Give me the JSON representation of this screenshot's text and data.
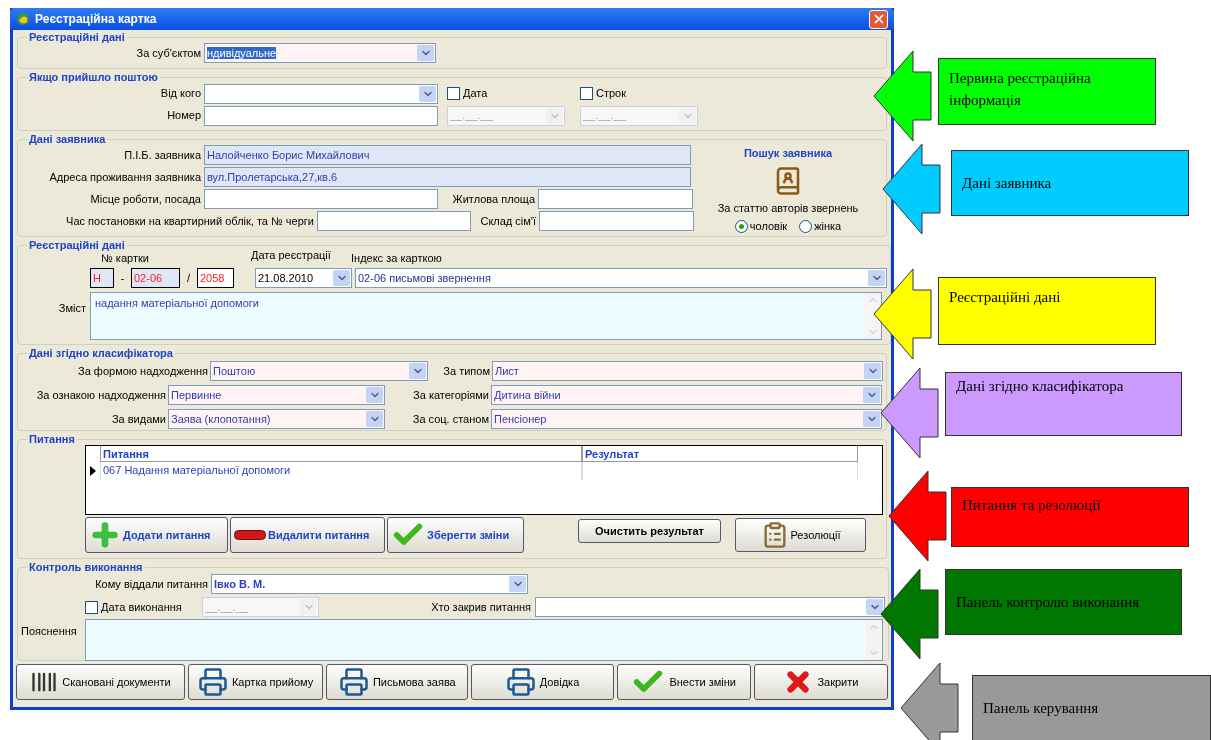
{
  "window": {
    "title": "Реєстраційна картка"
  },
  "registration": {
    "legend": "Реєстраційні дані",
    "subject": {
      "label": "За суб'єктом",
      "value": "ндивідуальне",
      "highlighted": true
    }
  },
  "mail": {
    "legend": "Якщо прийшло поштою",
    "from_label": "Від кого",
    "number_label": "Номер",
    "date": {
      "label": "Дата",
      "checked": false,
      "mask": "__.__.__"
    },
    "term": {
      "label": "Строк",
      "checked": false,
      "mask": "__.__.__"
    }
  },
  "applicant": {
    "legend": "Дані заявника",
    "fields": [
      {
        "label": "П.І.Б. заявника",
        "value": "Налойченко Борис Михайлович"
      },
      {
        "label": "Адреса проживання заявника",
        "value": "вул.Пролетарська,27,кв.6"
      },
      {
        "label": "Місце роботи, посада"
      },
      {
        "label": "Житлова площа"
      },
      {
        "label": "Час постановки на квартирний облік, та № черги"
      },
      {
        "label": "Склад сім'ї"
      }
    ],
    "search_label": "Пошук заявника",
    "gender_label": "За статтю авторів звернень",
    "genders": [
      {
        "label": "чоловік",
        "selected": true
      },
      {
        "label": "жінка",
        "selected": false
      }
    ]
  },
  "card": {
    "legend": "Реєстраційні дані",
    "number_label": "№ картки",
    "number_parts": [
      "Н",
      "02-06",
      "2058"
    ],
    "separators": [
      "-",
      "/"
    ],
    "date_label": "Дата реєстрації",
    "date": "21.08.2010",
    "index_label": "Індекс за карткою",
    "index": "02-06 письмові звернення",
    "content_label": "Зміст",
    "content": "надання матеріальної допомоги"
  },
  "classifier": {
    "legend": "Дані згідно класифікатора",
    "fields": [
      {
        "label": "За формою надходження",
        "value": "Поштою"
      },
      {
        "label": "За типом",
        "value": "Лист"
      },
      {
        "label": "За ознакою надходження",
        "value": "Первинне"
      },
      {
        "label": "За категоріями",
        "value": "Дитина війни"
      },
      {
        "label": "За видами",
        "value": "Заява (клопотання)"
      },
      {
        "label": "За соц. станом",
        "value": "Пенсіонер"
      }
    ]
  },
  "questions": {
    "legend": "Питання",
    "columns": [
      "Питання",
      "Результат"
    ],
    "rows": [
      {
        "cells": [
          "067 Надання матеріальної допомоги"
        ],
        "selected": true
      }
    ],
    "buttons": [
      {
        "label": "Додати питання",
        "kind": "plus"
      },
      {
        "label": "Видалити питання",
        "kind": "minus"
      },
      {
        "label": "Зберегти зміни",
        "kind": "check"
      }
    ],
    "side_buttons": [
      {
        "label": "Очистить результат"
      },
      {
        "label": "Резолюції",
        "kind": "clipboard"
      }
    ]
  },
  "control": {
    "legend": "Контроль виконання",
    "assigned_label": "Кому віддали питання",
    "assigned": "Івко В. М.",
    "done": {
      "label": "Дата виконання",
      "checked": false,
      "mask": "__.__.__"
    },
    "closed_label": "Хто закрив питання",
    "note_label": "Пояснення"
  },
  "toolbar": [
    {
      "label": "Скановані документи",
      "kind": "barcode"
    },
    {
      "label": "Картка прийому",
      "kind": "printer"
    },
    {
      "label": "Письмова заява",
      "kind": "printer"
    },
    {
      "label": "Довідка",
      "kind": "printer"
    },
    {
      "label": "Внести зміни",
      "kind": "check"
    },
    {
      "label": "Закрити",
      "kind": "cross"
    }
  ],
  "callouts": [
    {
      "text": "Первина реєстраційна інформація",
      "color": "#00ff00"
    },
    {
      "text": "Дані заявника",
      "color": "#00ccff"
    },
    {
      "text": "Реєстраційні дані",
      "color": "#ffff00"
    },
    {
      "text": "Дані згідно класифікатора",
      "color": "#cc99ff"
    },
    {
      "text": "Питання та резолюції",
      "color": "#ff0000"
    },
    {
      "text": "Панель контролю виконання",
      "color": "#007700"
    },
    {
      "text": "Панель керування",
      "color": "#999999"
    }
  ]
}
